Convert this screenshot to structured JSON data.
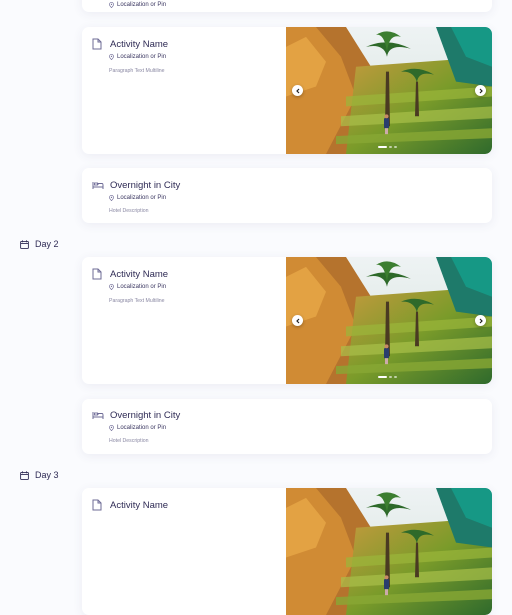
{
  "top_card": {
    "location": "Localization or Pin"
  },
  "day_labels": {
    "day2": "Day 2",
    "day3": "Day 3"
  },
  "activities": [
    {
      "title": "Activity Name",
      "location": "Localization or Pin",
      "description": "Paragraph Text Multiline"
    },
    {
      "title": "Activity Name",
      "location": "Localization or Pin",
      "description": "Paragraph Text Multiline"
    },
    {
      "title": "Activity Name"
    }
  ],
  "overnights": [
    {
      "title": "Overnight in City",
      "location": "Localization or Pin",
      "description": "Hotel Description"
    },
    {
      "title": "Overnight in City",
      "location": "Localization or Pin",
      "description": "Hotel Description"
    }
  ],
  "carousel": {
    "slide_count": 3,
    "active_slide": 1
  },
  "icons": {
    "activity": "document-icon",
    "overnight": "bed-icon",
    "location": "map-pin-icon",
    "day": "calendar-icon",
    "prev": "chevron-left-icon",
    "next": "chevron-right-icon"
  },
  "colors": {
    "background": "#fafbfe",
    "card": "#ffffff",
    "text": "#2f2b55",
    "muted": "#8a88a3",
    "icon": "#6e6b96"
  }
}
